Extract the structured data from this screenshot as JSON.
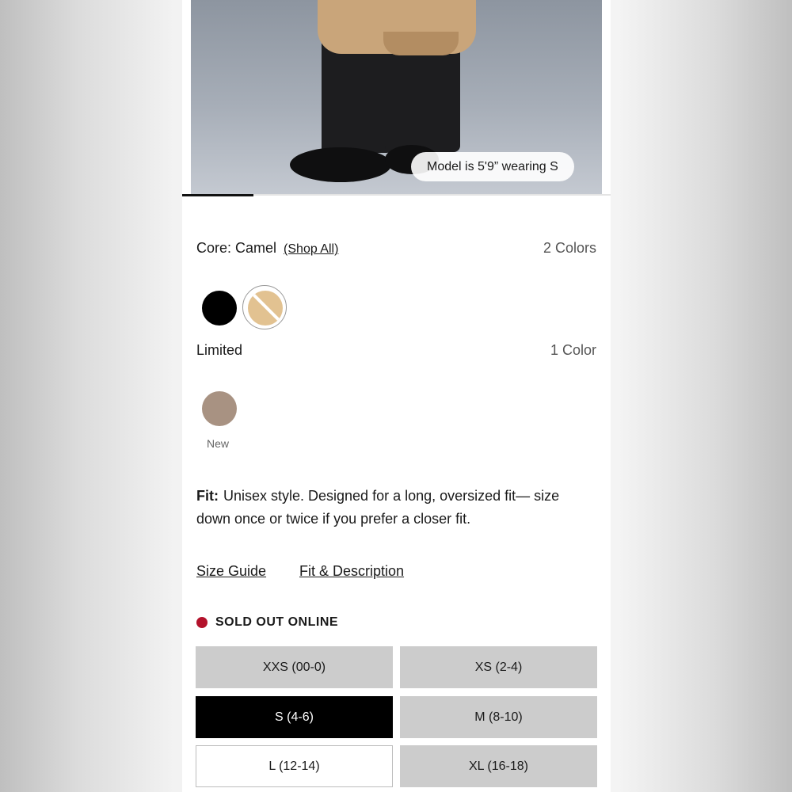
{
  "product_image": {
    "model_info": "Model is 5'9” wearing S",
    "carousel_progress": 0.17
  },
  "colors": {
    "core": {
      "label": "Core: Camel",
      "shop_all": "(Shop All)",
      "count": "2 Colors",
      "swatches": [
        {
          "name": "black",
          "color": "#000000"
        },
        {
          "name": "camel",
          "color": "#E2C291",
          "selected": true,
          "state": "crossed-out"
        }
      ]
    },
    "limited": {
      "label": "Limited",
      "count": "1 Color",
      "swatches": [
        {
          "name": "taupe",
          "color": "#A89282",
          "tag": "New"
        }
      ]
    }
  },
  "fit": {
    "label": "Fit:",
    "text": "Unisex style. Designed for a long, oversized fit— size down once or twice if you prefer a closer fit."
  },
  "links": {
    "size_guide": "Size Guide",
    "fit_description": "Fit & Description"
  },
  "availability": {
    "status": "SOLD OUT ONLINE",
    "status_color": "#B3122B"
  },
  "sizes": [
    {
      "label": "XXS (00-0)",
      "state": "unavailable"
    },
    {
      "label": "XS (2-4)",
      "state": "unavailable"
    },
    {
      "label": "S (4-6)",
      "state": "selected"
    },
    {
      "label": "M (8-10)",
      "state": "unavailable"
    },
    {
      "label": "L (12-14)",
      "state": "available"
    },
    {
      "label": "XL (16-18)",
      "state": "unavailable"
    }
  ]
}
